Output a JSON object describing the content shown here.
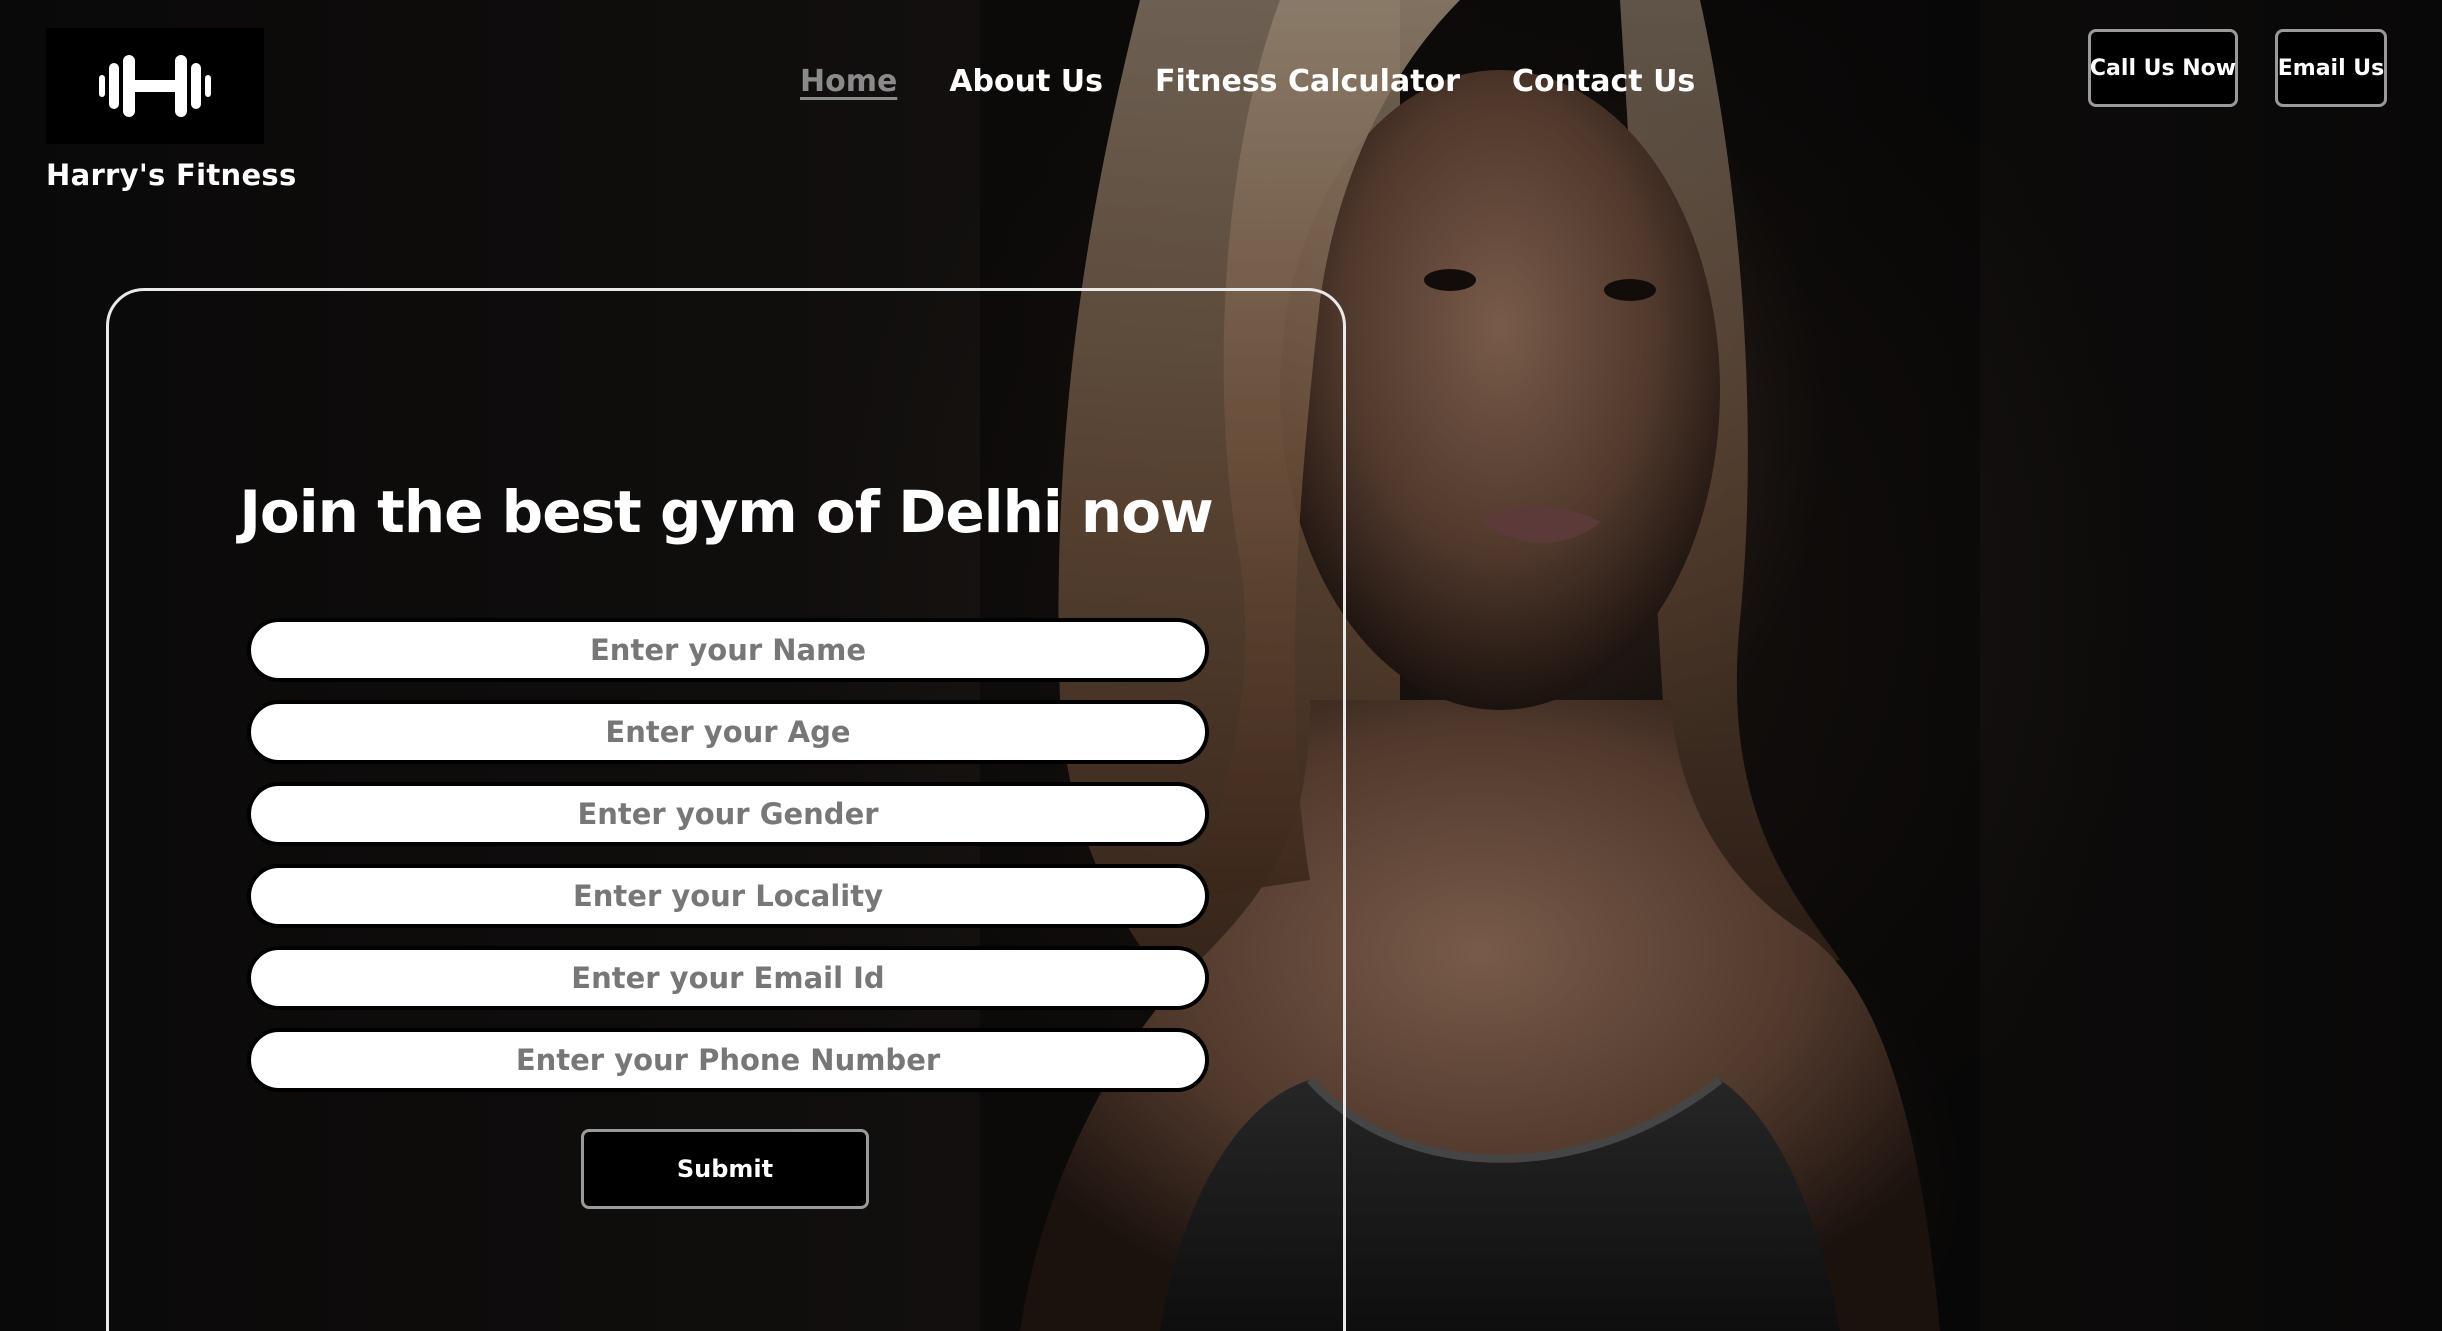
{
  "brand": {
    "name": "Harry's Fitness",
    "logo_icon": "dumbbell-icon"
  },
  "nav": {
    "items": [
      "Home",
      "About Us",
      "Fitness Calculator",
      "Contact Us"
    ],
    "active": "Home"
  },
  "header_actions": {
    "call": "Call Us Now",
    "email": "Email Us"
  },
  "form": {
    "title": "Join the best gym of Delhi now",
    "fields": [
      "Enter your Name",
      "Enter your Age",
      "Enter your Gender",
      "Enter your Locality",
      "Enter your Email Id",
      "Enter your Phone Number"
    ],
    "submit": "Submit"
  },
  "colors": {
    "background": "#050505",
    "text": "#ffffff",
    "active_nav": "#8a8a8a",
    "button_border": "#9a9a9a",
    "input_bg": "#ffffff"
  }
}
